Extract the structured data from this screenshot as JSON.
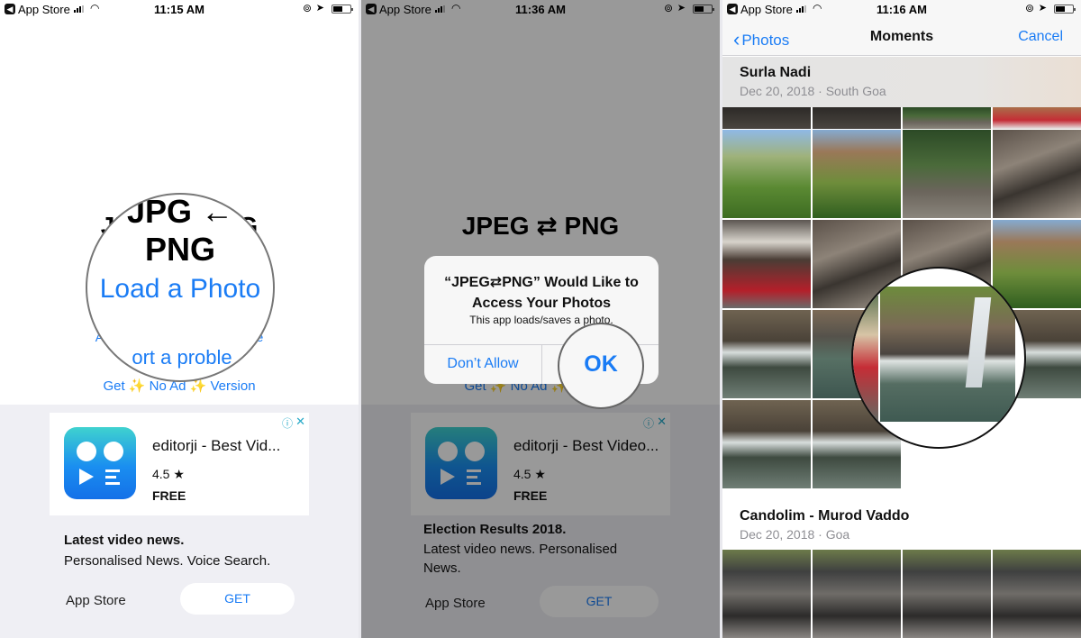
{
  "panels": [
    {
      "status_bar": {
        "back_app": "App Store",
        "time": "11:15 AM"
      },
      "app_title": "JPEG ⇄ PNG",
      "app_title_magnified_fragment": "JPG ← PNG",
      "buttons": {
        "load_photo": "Load a Photo",
        "ask_feature_fragment_left": "As",
        "ask_feature_fragment_right": "ure",
        "report_problem": "Report a problem",
        "report_problem_visible": "ort a proble",
        "get_no_ad": "Get ✨ No Ad ✨ Version"
      },
      "ad": {
        "app_name": "editorji - Best Vid...",
        "rating": "4.5 ★",
        "price": "FREE",
        "headline": "Latest video news.",
        "description": "Personalised News. Voice Search.",
        "store_label": "App Store",
        "get_button": "GET",
        "info_icon": "ⓘ",
        "close_icon": "✕"
      }
    },
    {
      "status_bar": {
        "back_app": "App Store",
        "time": "11:36 AM"
      },
      "app_title": "JPEG ⇄ PNG",
      "get_no_ad": "Get ✨ No Ad ✨ Version",
      "alert": {
        "title": "“JPEG⇄PNG” Would Like to Access Your Photos",
        "message": "This app loads/saves a photo.",
        "deny_button": "Don’t Allow",
        "ok_button": "OK"
      },
      "ad": {
        "app_name": "editorji - Best Video...",
        "rating": "4.5 ★",
        "price": "FREE",
        "headline": "Election Results 2018.",
        "description": "Latest video news. Personalised News.",
        "store_label": "App Store",
        "get_button": "GET",
        "info_icon": "ⓘ",
        "close_icon": "✕"
      }
    },
    {
      "status_bar": {
        "back_app": "App Store",
        "time": "11:16 AM"
      },
      "nav": {
        "back_label": "Photos",
        "title": "Moments",
        "cancel_label": "Cancel"
      },
      "moments": [
        {
          "title": "Surla Nadi",
          "subtitle": "Dec 20, 2018  ·  South Goa"
        },
        {
          "title": "Candolim - Murod Vaddo",
          "subtitle": "Dec 20, 2018  ·  Goa"
        }
      ]
    }
  ],
  "icons": {
    "back_app": "◀",
    "wifi": "◠",
    "orientation_lock": "⊚",
    "location": "➤",
    "chevron_left": "‹"
  },
  "colors": {
    "accent_blue": "#1a7cf5",
    "ad_info": "#26a9c7",
    "ad_background": "#efeff4"
  }
}
